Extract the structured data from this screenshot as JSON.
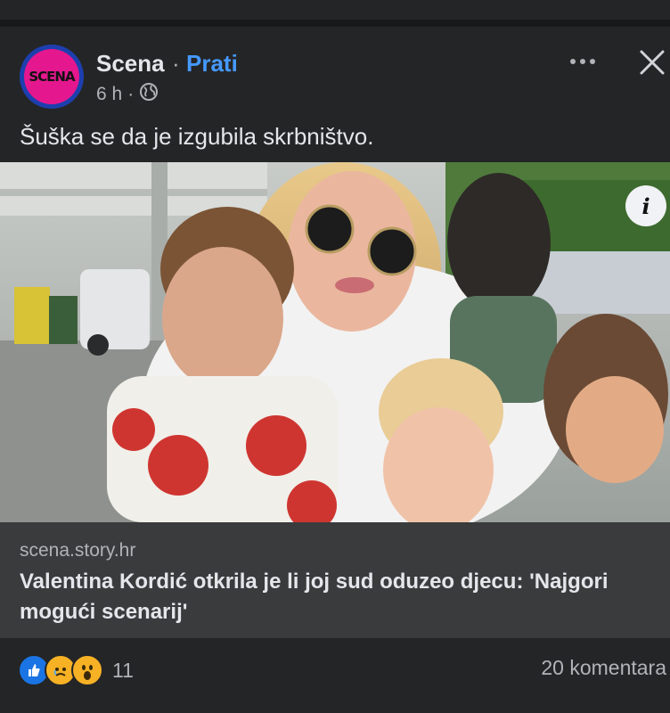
{
  "post": {
    "page_name": "Scena",
    "separator": "·",
    "follow_label": "Prati",
    "time": "6 h",
    "meta_dot": "·",
    "avatar_text": "SCENA",
    "caption": "Šuška se da je izgubila skrbništvo.",
    "icons": {
      "more": "more-horizontal-icon",
      "close": "close-icon",
      "globe": "globe-icon",
      "info": "info-icon"
    }
  },
  "link": {
    "domain": "scena.story.hr",
    "headline": "Valentina Kordić otkrila je li joj sud oduzeo djecu: 'Najgori mogući scenarij'",
    "info_glyph": "i"
  },
  "footer": {
    "reactions": [
      "like",
      "sad",
      "wow"
    ],
    "reaction_count": "11",
    "comments_label": "20 komentara"
  },
  "colors": {
    "background": "#242526",
    "link_box": "#3a3b3c",
    "follow_blue": "#4599ff",
    "avatar_pink": "#e5178e",
    "avatar_ring": "#1d3fae"
  }
}
